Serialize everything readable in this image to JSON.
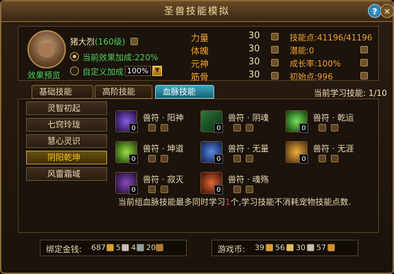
{
  "window": {
    "title": "圣兽技能模拟"
  },
  "pet": {
    "name": "猪大烈",
    "level": "(160级)",
    "preview_label": "效果预览",
    "current_effect_label": "当前效果加成:220%",
    "custom_label": "自定义加成",
    "custom_value": "100%"
  },
  "stats": [
    {
      "label": "力量",
      "value": "30"
    },
    {
      "label": "体魄",
      "value": "30"
    },
    {
      "label": "元神",
      "value": "30"
    },
    {
      "label": "筋骨",
      "value": "30"
    }
  ],
  "right_stats": [
    "技能点:41196/41196",
    "潜能:0",
    "成长率:100%",
    "初始点:996"
  ],
  "tabs": [
    "基础技能",
    "高阶技能",
    "血脉技能"
  ],
  "active_tab": "血脉技能",
  "learn_count": "当前学习技能: 1/10",
  "categories": [
    "灵智初起",
    "七窍玲珑",
    "慧心灵识",
    "阴阳乾坤",
    "风雷霜域"
  ],
  "active_category": "阴阳乾坤",
  "skills": [
    {
      "name": "兽符 · 阳神",
      "count": "0",
      "color": "#3a1a6a"
    },
    {
      "name": "兽符 · 阴魂",
      "count": "0",
      "color": "#1a5a3a"
    },
    {
      "name": "兽符 · 乾运",
      "count": "0",
      "color": "#2a6a2a"
    },
    {
      "name": "兽符 · 坤道",
      "count": "0",
      "color": "#3a8a1a"
    },
    {
      "name": "兽符 · 无量",
      "count": "0",
      "color": "#1a3a9a"
    },
    {
      "name": "兽符 · 无涯",
      "count": "0",
      "color": "#aa6a1a"
    },
    {
      "name": "兽符 · 寂灭",
      "count": "0",
      "color": "#4a1a6a"
    },
    {
      "name": "兽符 · 魂殇",
      "count": "0",
      "color": "#8a3a1a"
    }
  ],
  "info": {
    "before": "当前组血脉技能最多同时学习",
    "highlight": "1",
    "after": "个,学习技能不消耗宠物技能点数."
  },
  "bound_money": {
    "label": "绑定金钱:",
    "gold": "687",
    "silver": "5",
    "copper": "4",
    "extra": "20"
  },
  "game_money": {
    "label": "游戏币:",
    "v1": "39",
    "v2": "56",
    "v3": "30",
    "v4": "57"
  },
  "colors": {
    "accent_green": "#4cd15a",
    "accent_orange": "#f0a030",
    "active_tab": "#38a8c0"
  }
}
